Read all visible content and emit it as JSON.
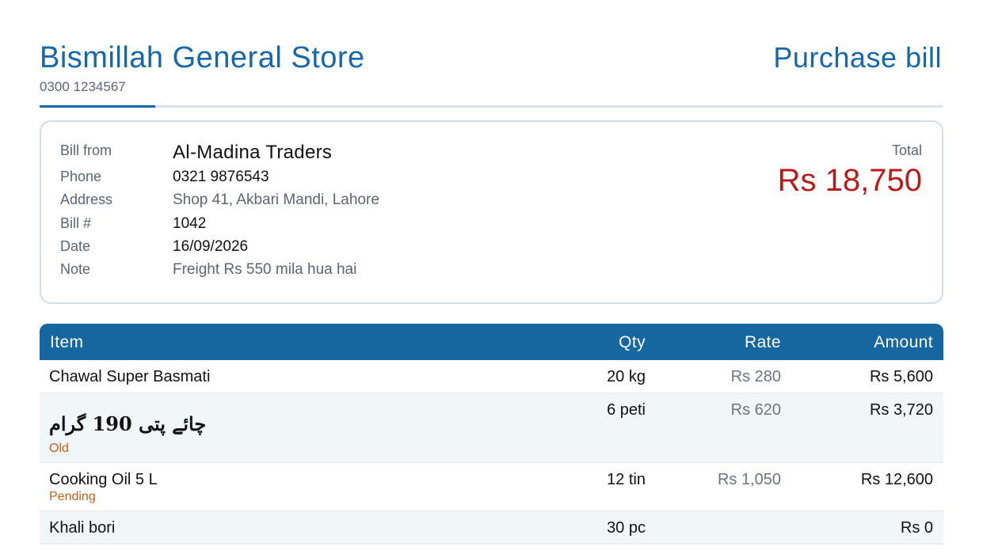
{
  "header": {
    "store_name": "Bismillah General Store",
    "store_phone": "0300 1234567",
    "document_title": "Purchase bill"
  },
  "bill_info": {
    "labels": {
      "bill_from": "Bill from",
      "phone": "Phone",
      "address": "Address",
      "bill_no": "Bill #",
      "date": "Date",
      "note": "Note"
    },
    "bill_from": "Al-Madina Traders",
    "phone": "0321 9876543",
    "address": "Shop 41, Akbari Mandi, Lahore",
    "bill_no": "1042",
    "date": "16/09/2026",
    "note": "Freight Rs 550 mila hua hai",
    "total_label": "Total",
    "total_value": "Rs 18,750"
  },
  "table": {
    "columns": [
      "Item",
      "Qty",
      "Rate",
      "Amount"
    ],
    "rows": [
      {
        "item": "Chawal Super Basmati",
        "tag": "",
        "qty": "20 kg",
        "rate": "Rs 280",
        "amount": "Rs 5,600"
      },
      {
        "item": "چائے پتی 190 گرام",
        "tag": "Old",
        "qty": "6 peti",
        "rate": "Rs 620",
        "amount": "Rs 3,720"
      },
      {
        "item": "Cooking Oil 5 L",
        "tag": "Pending",
        "qty": "12 tin",
        "rate": "Rs 1,050",
        "amount": "Rs 12,600"
      },
      {
        "item": "Khali bori",
        "tag": "",
        "qty": "30 pc",
        "rate": "",
        "amount": "Rs 0"
      }
    ]
  },
  "colors": {
    "accent": "#1668a8",
    "header_bg": "#1666a0",
    "total": "#b71c1c",
    "tag": "#c4611a",
    "muted": "#5b6672"
  }
}
